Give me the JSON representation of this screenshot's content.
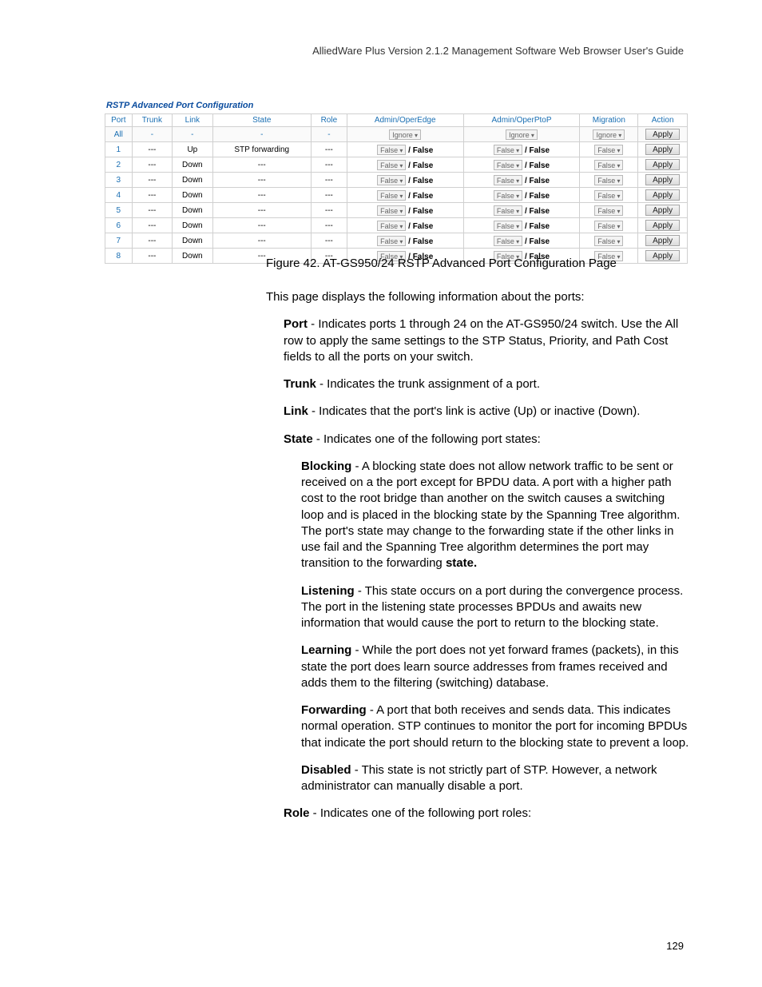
{
  "doc_header": "AlliedWare Plus Version 2.1.2 Management Software Web Browser User's Guide",
  "page_number": "129",
  "figure_caption": "Figure 42. AT-GS950/24 RSTP Advanced Port Configuration Page",
  "intro_line": "This page displays the following information about the ports:",
  "bullets": {
    "port_label": "Port",
    "port_text": " - Indicates ports 1 through 24 on the AT-GS950/24 switch. Use the All row to apply the same settings to the STP Status, Priority, and Path Cost fields to all the ports on your switch.",
    "trunk_label": "Trunk",
    "trunk_text": " - Indicates the trunk assignment of a port.",
    "link_label": "Link",
    "link_text": " - Indicates that the port's link is active (Up) or inactive (Down).",
    "state_label": "State",
    "state_text": " - Indicates one of the following port states:",
    "blocking_label": "Blocking",
    "blocking_text": " - A blocking state does not allow network traffic to be sent or received on a the port except for BPDU data. A port with a higher path cost to the root bridge than another on the switch causes a switching loop and is placed in the blocking state by the Spanning Tree algorithm. The port's state may change to the forwarding state if the other links in use fail and the Spanning Tree algorithm determines the port may transition to the forwarding ",
    "blocking_tail": "state.",
    "listening_label": "Listening",
    "listening_text": " - This state occurs on a port during the convergence process. The port in the listening state processes BPDUs and awaits new information that would cause the port to return to the blocking state.",
    "learning_label": "Learning",
    "learning_text": " - While the port does not yet forward frames (packets), in this state the port does learn source addresses from frames received and adds them to the filtering (switching) database.",
    "forwarding_label": "Forwarding",
    "forwarding_text": " - A port that both receives and sends data. This indicates normal operation. STP continues to monitor the port for incoming BPDUs that indicate the port should return to the blocking state to prevent a loop.",
    "disabled_label": "Disabled",
    "disabled_text": " - This state is not strictly part of STP. However, a network administrator can manually disable a port.",
    "role_label": "Role",
    "role_text": " - Indicates one of the following port roles:"
  },
  "screenshot": {
    "panel_title": "RSTP Advanced Port Configuration",
    "headers": {
      "port": "Port",
      "trunk": "Trunk",
      "link": "Link",
      "state": "State",
      "role": "Role",
      "edge": "Admin/OperEdge",
      "ptop": "Admin/OperPtoP",
      "migration": "Migration",
      "action": "Action"
    },
    "all_label": "All",
    "dash": "-",
    "triple_dash": "---",
    "ignore": "Ignore",
    "false_sel": "False",
    "oper_false": "/ False",
    "apply": "Apply",
    "rows": [
      {
        "port": "1",
        "link": "Up",
        "state": "STP forwarding"
      },
      {
        "port": "2",
        "link": "Down",
        "state": "---"
      },
      {
        "port": "3",
        "link": "Down",
        "state": "---"
      },
      {
        "port": "4",
        "link": "Down",
        "state": "---"
      },
      {
        "port": "5",
        "link": "Down",
        "state": "---"
      },
      {
        "port": "6",
        "link": "Down",
        "state": "---"
      },
      {
        "port": "7",
        "link": "Down",
        "state": "---"
      },
      {
        "port": "8",
        "link": "Down",
        "state": "---"
      }
    ]
  }
}
